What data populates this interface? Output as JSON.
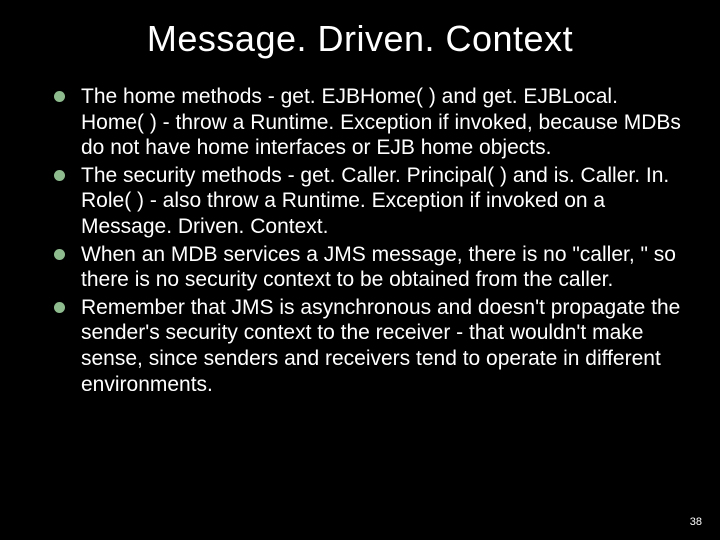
{
  "slide": {
    "title": "Message. Driven. Context",
    "bullets": [
      "The home methods - get. EJBHome( ) and get. EJBLocal. Home( ) - throw a Runtime. Exception if invoked, because MDBs do not have home interfaces or EJB home objects.",
      "The security methods - get. Caller. Principal( ) and is. Caller. In. Role( ) - also throw a Runtime. Exception if invoked on a Message. Driven. Context.",
      "When an MDB services a JMS message, there is no \"caller, \" so there is no security context to be obtained from the caller.",
      "Remember that JMS is asynchronous and doesn't propagate the sender's security context to the receiver - that wouldn't make sense, since senders and receivers tend to operate in different environments."
    ],
    "page_number": "38"
  }
}
